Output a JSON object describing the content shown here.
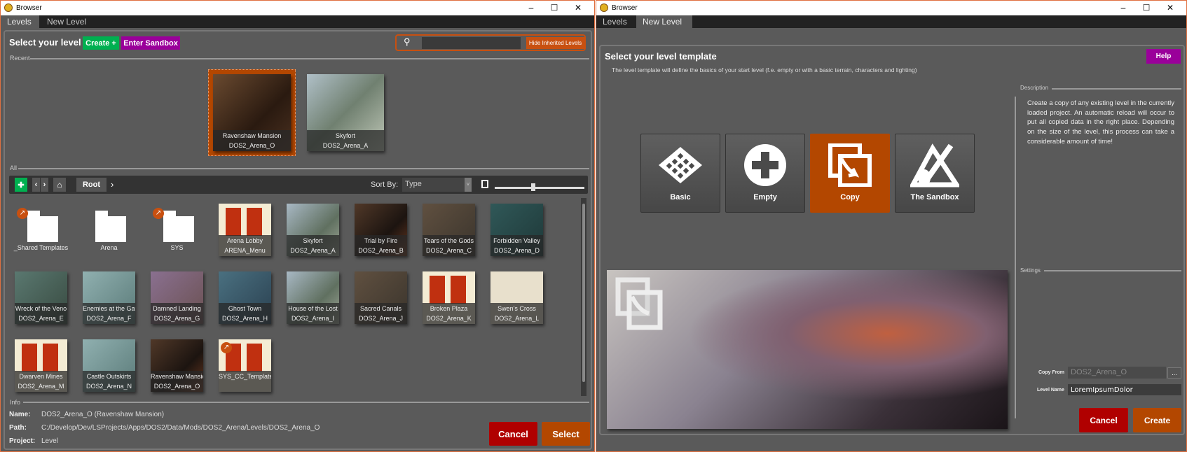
{
  "left": {
    "window_title": "Browser",
    "tabs": [
      {
        "label": "Levels",
        "active": true
      },
      {
        "label": "New Level",
        "active": false
      }
    ],
    "header": {
      "title": "Select your level",
      "create_label": "Create +",
      "sandbox_label": "Enter Sandbox",
      "search_value": "",
      "hide_inherited_label": "Hide Inherited Levels"
    },
    "recent_label": "Recent",
    "recent": [
      {
        "name": "Ravenshaw Mansion",
        "id": "DOS2_Arena_O",
        "selected": true
      },
      {
        "name": "Skyfort",
        "id": "DOS2_Arena_A",
        "selected": false
      }
    ],
    "all_label": "All",
    "toolbar": {
      "root_label": "Root",
      "sort_by_label": "Sort By:",
      "sort_value": "Type",
      "zoom_level": 0.45
    },
    "items": [
      {
        "type": "folder",
        "name": "_Shared Templates",
        "inherited": true
      },
      {
        "type": "folder",
        "name": "Arena",
        "inherited": false
      },
      {
        "type": "folder",
        "name": "SYS",
        "inherited": true
      },
      {
        "type": "level",
        "name": "Arena Lobby",
        "id": "ARENA_Menu",
        "thumb": "poster"
      },
      {
        "type": "level",
        "name": "Skyfort",
        "id": "DOS2_Arena_A",
        "thumb": "sky"
      },
      {
        "type": "level",
        "name": "Trial by Fire",
        "id": "DOS2_Arena_B",
        "thumb": "fire"
      },
      {
        "type": "level",
        "name": "Tears of the Gods",
        "id": "DOS2_Arena_C",
        "thumb": "brown"
      },
      {
        "type": "level",
        "name": "Forbidden Valley",
        "id": "DOS2_Arena_D",
        "thumb": "teal"
      },
      {
        "type": "level",
        "name": "Wreck of the Veno",
        "id": "DOS2_Arena_E",
        "thumb": "green"
      },
      {
        "type": "level",
        "name": "Enemies at the Gat",
        "id": "DOS2_Arena_F",
        "thumb": "ice"
      },
      {
        "type": "level",
        "name": "Damned Landing",
        "id": "DOS2_Arena_G",
        "thumb": "purple"
      },
      {
        "type": "level",
        "name": "Ghost Town",
        "id": "DOS2_Arena_H",
        "thumb": "blue"
      },
      {
        "type": "level",
        "name": "House of the Lost",
        "id": "DOS2_Arena_I",
        "thumb": "sky"
      },
      {
        "type": "level",
        "name": "Sacred Canals",
        "id": "DOS2_Arena_J",
        "thumb": "brown"
      },
      {
        "type": "level",
        "name": "Broken Plaza",
        "id": "DOS2_Arena_K",
        "thumb": "poster"
      },
      {
        "type": "level",
        "name": "Swen's Cross",
        "id": "DOS2_Arena_L",
        "thumb": "map"
      },
      {
        "type": "level",
        "name": "Dwarven Mines",
        "id": "DOS2_Arena_M",
        "thumb": "poster"
      },
      {
        "type": "level",
        "name": "Castle Outskirts",
        "id": "DOS2_Arena_N",
        "thumb": "ice"
      },
      {
        "type": "level",
        "name": "Ravenshaw Mansic",
        "id": "DOS2_Arena_O",
        "thumb": "fire"
      },
      {
        "type": "level",
        "name": "SYS_CC_Template_",
        "id": "",
        "thumb": "poster",
        "inherited": true
      }
    ],
    "info": {
      "label": "Info",
      "name_label": "Name:",
      "name_value": "DOS2_Arena_O (Ravenshaw Mansion)",
      "path_label": "Path:",
      "path_value": "C:/Develop/Dev/LSProjects/Apps/DOS2/Data/Mods/DOS2_Arena/Levels/DOS2_Arena_O",
      "project_label": "Project:",
      "project_value": "Level"
    },
    "cancel_label": "Cancel",
    "select_label": "Select"
  },
  "right": {
    "window_title": "Browser",
    "tabs": [
      {
        "label": "Levels",
        "active": false
      },
      {
        "label": "New Level",
        "active": true
      }
    ],
    "title": "Select your level template",
    "subtitle": "The level template will define the basics of your start level (f.e. empty or with a basic terrain, characters and lighting)",
    "help_label": "Help",
    "templates": [
      {
        "label": "Basic",
        "icon": "grid-icon",
        "selected": false
      },
      {
        "label": "Empty",
        "icon": "plus-circle-icon",
        "selected": false
      },
      {
        "label": "Copy",
        "icon": "copy-icon",
        "selected": true
      },
      {
        "label": "The Sandbox",
        "icon": "sandbox-icon",
        "selected": false
      }
    ],
    "description_label": "Description",
    "description": "Create a copy of any existing level in the currently loaded project. An automatic reload will occur to put all copied data in the right place. Depending on the size of the level, this process can take a considerable amount of time!",
    "settings_label": "Settings",
    "copy_from_label": "Copy From",
    "copy_from_value": "DOS2_Arena_O",
    "browse_label": "...",
    "level_name_label": "Level Name",
    "level_name_value": "LoremIpsumDolor",
    "cancel_label": "Cancel",
    "create_label": "Create"
  },
  "colors": {
    "accent": "#b34700",
    "cancel": "#b00000",
    "create_green": "#00b050",
    "purple": "#9a009a"
  }
}
